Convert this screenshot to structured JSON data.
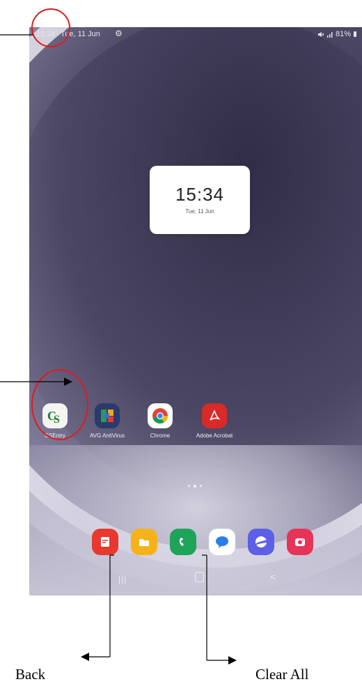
{
  "status_bar": {
    "time": "15:34",
    "date": "Tue, 11 Jun",
    "signal_text": "⚙",
    "battery_text": "81%"
  },
  "clock_widget": {
    "time": "15:34",
    "date": "Tue, 11 Jun"
  },
  "apps": [
    {
      "label": "CSEntry",
      "icon": "csentry-icon",
      "color": "#1f7a2e"
    },
    {
      "label": "AVG AntiVirus",
      "icon": "avg-antivirus-icon",
      "color": "#2a3b6b"
    },
    {
      "label": "Chrome",
      "icon": "chrome-icon",
      "color": "#ffffff"
    },
    {
      "label": "Adobe Acrobat",
      "icon": "adobe-acrobat-icon",
      "color": "#d92a2a"
    }
  ],
  "dock": [
    {
      "icon": "notes-icon",
      "color": "#e8382f"
    },
    {
      "icon": "my-files-icon",
      "color": "#f6b21a"
    },
    {
      "icon": "phone-icon",
      "color": "#1ea35a"
    },
    {
      "icon": "messages-icon",
      "color": "#2b7de9"
    },
    {
      "icon": "internet-icon",
      "color": "#5d5fe6"
    },
    {
      "icon": "camera-icon",
      "color": "#e63458"
    }
  ],
  "nav": {
    "recents": "|||",
    "back": "<"
  },
  "annotations": {
    "back_label": "Back",
    "clear_all_label": "Clear All",
    "highlight_color": "#e01b1b"
  }
}
